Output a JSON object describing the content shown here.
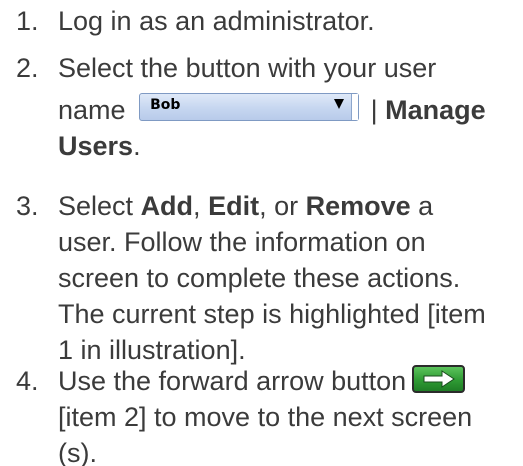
{
  "steps": [
    {
      "number": "1.",
      "text": "Log in as an administrator."
    },
    {
      "number": "2.",
      "line1": "Select the button with your user",
      "pre": "name",
      "dropdown_value": "Bob",
      "separator": "|",
      "bold": "Manage",
      "bold2": "Users",
      "end": "."
    },
    {
      "number": "3.",
      "pre": "Select",
      "add": "Add",
      "comma1": ",",
      "edit": "Edit",
      "or": ", or",
      "remove": "Remove",
      "a": "a",
      "line2": "user. Follow the information on",
      "line3": "screen to complete these actions.",
      "line4": "The current step is highlighted [item",
      "line5": "1 in illustration]."
    },
    {
      "number": "4.",
      "line1": "Use the forward arrow button",
      "line2": "[item 2] to move to the next screen",
      "line3": "(s)."
    }
  ],
  "icons": {
    "dropdown_arrow": "chevron-down-icon",
    "forward_button": "arrow-right-icon"
  },
  "colors": {
    "text": "#3b3b3b",
    "dropdown_fill": "#c6d6f0",
    "forward_button": "#2f9b34"
  }
}
